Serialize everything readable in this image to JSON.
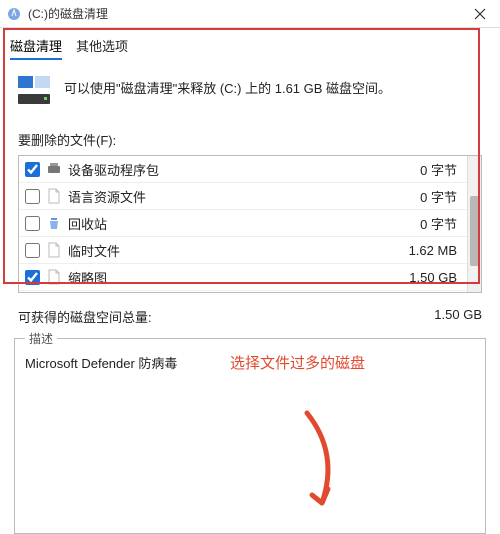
{
  "window": {
    "title": "(C:)的磁盘清理"
  },
  "tabs": {
    "t0": "磁盘清理",
    "t1": "其他选项"
  },
  "info": {
    "message": "可以使用\"磁盘清理\"来释放  (C:) 上的 1.61 GB 磁盘空间。"
  },
  "list": {
    "label": "要删除的文件(F):",
    "items": [
      {
        "name": "设备驱动程序包",
        "size": "0 字节",
        "checked": true,
        "icon": "driver"
      },
      {
        "name": "语言资源文件",
        "size": "0 字节",
        "checked": false,
        "icon": "file"
      },
      {
        "name": "回收站",
        "size": "0 字节",
        "checked": false,
        "icon": "recycle"
      },
      {
        "name": "临时文件",
        "size": "1.62 MB",
        "checked": false,
        "icon": "file"
      },
      {
        "name": "缩略图",
        "size": "1.50 GB",
        "checked": true,
        "icon": "file"
      }
    ]
  },
  "total": {
    "label": "可获得的磁盘空间总量:",
    "value": "1.50 GB"
  },
  "description": {
    "legend": "描述",
    "text": "Microsoft Defender 防病毒"
  },
  "annotation": "选择文件过多的磁盘"
}
